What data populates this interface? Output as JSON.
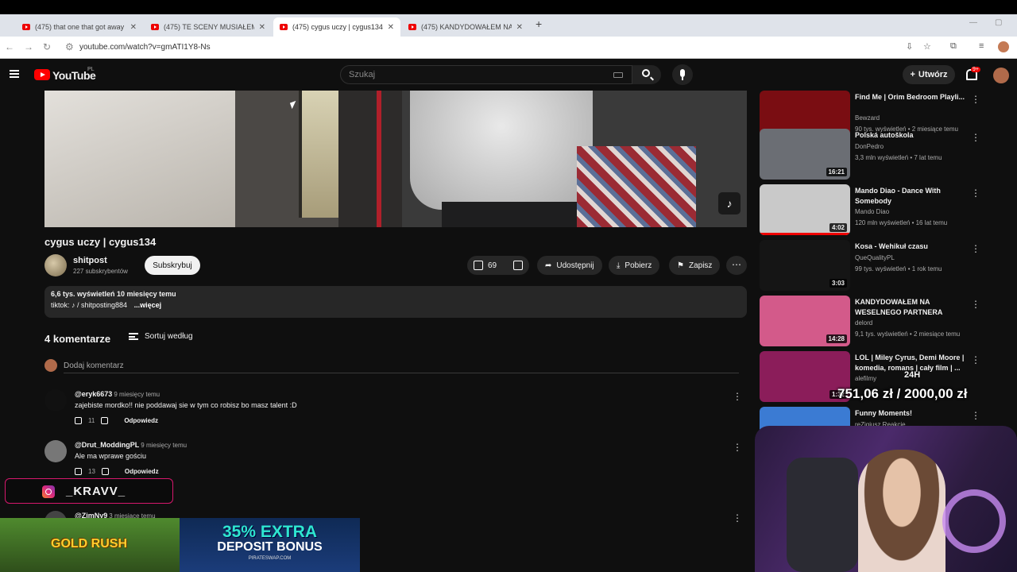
{
  "browser": {
    "tabs": [
      {
        "label": "(475) that one that got away re",
        "active": false
      },
      {
        "label": "(475) TE SCENY MUSIAŁEM W",
        "active": false
      },
      {
        "label": "(475) cygus uczy | cygus134 - Y",
        "active": true
      },
      {
        "label": "(475) KANDYDOWAŁEM NA W",
        "active": false
      }
    ],
    "url": "youtube.com/watch?v=gmATI1Y8-Ns"
  },
  "youtube": {
    "logo_text": "YouTube",
    "country": "PL",
    "search_placeholder": "Szukaj",
    "create_label": "Utwórz",
    "notif_badge": "9+"
  },
  "video": {
    "title": "cygus uczy | cygus134",
    "channel": "shitpost",
    "subscribers": "227 subskrybentów",
    "subscribe_label": "Subskrybuj",
    "likes": "69",
    "share_label": "Udostępnij",
    "download_label": "Pobierz",
    "save_label": "Zapisz",
    "description": {
      "views_date": "6,6 tys. wyświetleń  10 miesięcy temu",
      "line2": "tiktok:  ♪ / shitposting884",
      "more": "...więcej"
    }
  },
  "comments": {
    "count": "4 komentarze",
    "sort_label": "Sortuj według",
    "add_placeholder": "Dodaj komentarz",
    "reply_label": "Odpowiedz",
    "items": [
      {
        "handle": "@eryk6673",
        "time": "9 miesięcy temu",
        "text": "zajebiste mordko!! nie poddawaj sie w tym co robisz bo masz talent :D",
        "likes": "11"
      },
      {
        "handle": "@Drut_ModdingPL",
        "time": "9 miesięcy temu",
        "text": "Ale ma wprawe gościu",
        "likes": "13"
      },
      {
        "handle": "@ZimNy9",
        "time": "3 miesiące temu",
        "text": "",
        "likes": ""
      }
    ]
  },
  "sidebar": {
    "items": [
      {
        "title": "Find Me | Orim Bedroom Playli...",
        "channel": "Bewzard",
        "meta": "90 tys. wyświetleń • 2 miesiące temu",
        "duration": "1:17:07",
        "color": "#7a0d12"
      },
      {
        "title": "Polská autoškola",
        "channel": "DonPedro",
        "meta": "3,3 mln wyświetleń • 7 lat temu",
        "duration": "16:21",
        "color": "#6b6e74"
      },
      {
        "title": "Mando Diao - Dance With Somebody",
        "channel": "Mando Diao",
        "meta": "120 mln wyświetleń • 16 lat temu",
        "duration": "4:02",
        "color": "#c9c9c9"
      },
      {
        "title": "Kosa - Wehikuł czasu",
        "channel": "QueQualityPL",
        "meta": "99 tys. wyświetleń • 1 rok temu",
        "duration": "3:03",
        "color": "#151515"
      },
      {
        "title": "KANDYDOWAŁEM NA WESELNEGO PARTNERA",
        "channel": "delord",
        "meta": "9,1 tys. wyświetleń • 2 miesiące temu",
        "duration": "14:28",
        "color": "#d35a8a"
      },
      {
        "title": "LOL | Miley Cyrus, Demi Moore | komedia, romans | cały film | ...",
        "channel": "alefilmy",
        "meta": "",
        "duration": "1:32",
        "color": "#8b1d5a"
      },
      {
        "title": "Funny Moments!",
        "channel": "reZigiusz Reakcje",
        "meta": "",
        "duration": "",
        "color": "#3b7bd3"
      }
    ]
  },
  "overlay": {
    "period": "24H",
    "money": "751,06 zł / 2000,00 zł",
    "instagram": "_KRAVV_",
    "ad_left": "GOLD RUSH",
    "ad_right_big": "35% EXTRA",
    "ad_right_mid": "DEPOSIT BONUS",
    "ad_right_small": "PIRATESWAP.COM"
  }
}
